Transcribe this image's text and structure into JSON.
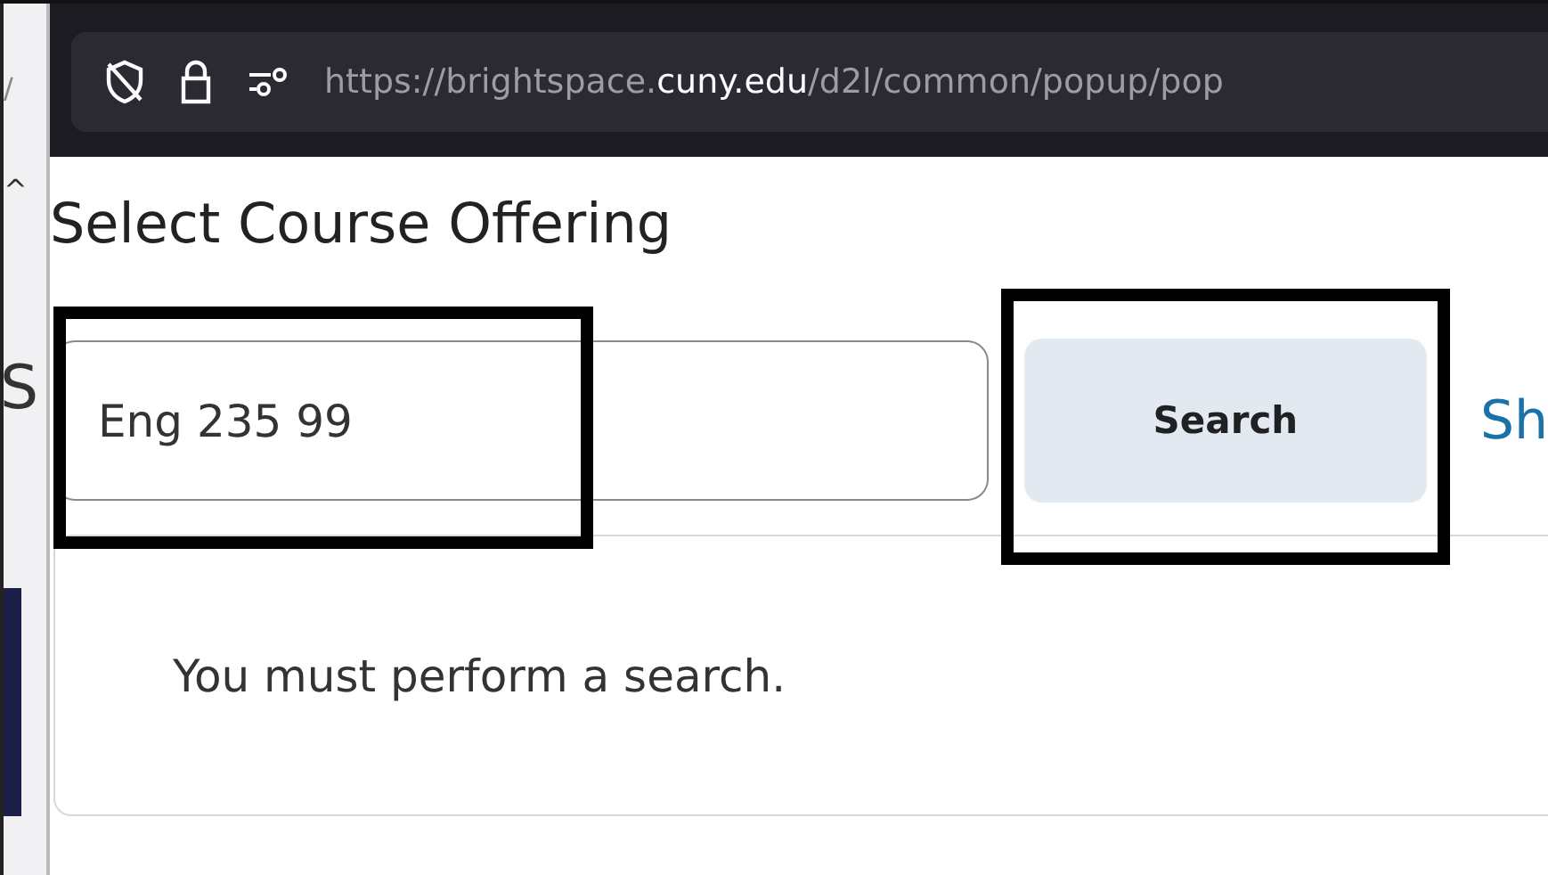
{
  "background_page": {
    "fragments": [
      "/",
      "^",
      "S"
    ]
  },
  "address_bar": {
    "url_prefix": "https://brightspace.",
    "url_domain": "cuny.edu",
    "url_path": "/d2l/common/popup/pop"
  },
  "dialog": {
    "title": "Select Course Offering",
    "search_field": {
      "value": "Eng 235 99"
    },
    "search_button": "Search",
    "link": "Sh",
    "message": "You must perform a search."
  },
  "annotations": [
    {
      "kind": "highlight"
    },
    {
      "kind": "highlight"
    }
  ]
}
